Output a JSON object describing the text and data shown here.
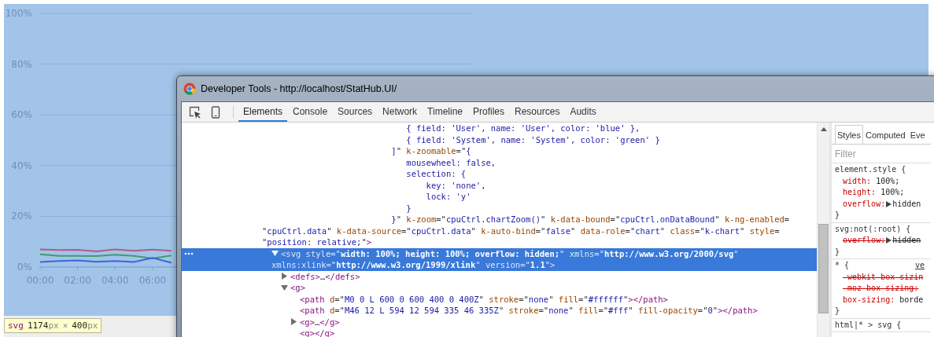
{
  "chart_page": {
    "chart_data": {
      "type": "line",
      "grid": true,
      "x": [
        0,
        1,
        2,
        3,
        4,
        5,
        6,
        7
      ],
      "xlim": [
        0,
        23
      ],
      "xticks": [
        {
          "value": 0,
          "label": "00:00"
        },
        {
          "value": 2,
          "label": "02:00"
        },
        {
          "value": 4,
          "label": "04:00"
        },
        {
          "value": 6,
          "label": "06:00"
        }
      ],
      "ylim": [
        0,
        100
      ],
      "yticks": [
        {
          "value": 0,
          "label": "0%"
        },
        {
          "value": 20,
          "label": "20%"
        },
        {
          "value": 40,
          "label": "40%"
        },
        {
          "value": 60,
          "label": "60%"
        },
        {
          "value": 80,
          "label": "80%"
        },
        {
          "value": 100,
          "label": "100%"
        }
      ],
      "series": [
        {
          "color": "#b05c84",
          "values": [
            7,
            6.7,
            6.8,
            6.2,
            7,
            6.4,
            6.9,
            6.4
          ]
        },
        {
          "color": "#3e9d6e",
          "values": [
            5,
            4.4,
            4.4,
            4.3,
            4.9,
            4.4,
            3.4,
            4.6
          ]
        },
        {
          "color": "#3f63e0",
          "values": [
            2,
            2.4,
            2.6,
            2.1,
            2.4,
            2,
            3.6,
            1.7
          ]
        }
      ]
    }
  },
  "size_tooltip": {
    "segments": [
      {
        "kind": "tag",
        "text": "svg"
      },
      {
        "kind": "num",
        "text": "1174"
      },
      {
        "kind": "unit",
        "text": "px"
      },
      {
        "kind": "sep",
        "text": "×"
      },
      {
        "kind": "num",
        "text": "400"
      },
      {
        "kind": "unit",
        "text": "px"
      }
    ]
  },
  "devtools": {
    "title": "Developer Tools - http://localhost/StatHub.UI/",
    "tabs": [
      {
        "label": "Elements",
        "selected": true
      },
      {
        "label": "Console",
        "selected": false
      },
      {
        "label": "Sources",
        "selected": false
      },
      {
        "label": "Network",
        "selected": false
      },
      {
        "label": "Timeline",
        "selected": false
      },
      {
        "label": "Profiles",
        "selected": false
      },
      {
        "label": "Resources",
        "selected": false
      },
      {
        "label": "Audits",
        "selected": false
      }
    ],
    "dom_tree": {
      "continued": true,
      "selected": false,
      "lines": [
        [
          {
            "kind": "val",
            "text": "                             { field: 'User', name: 'User', color: 'blue' },"
          }
        ],
        [
          {
            "kind": "val",
            "text": "                             { field: 'System', name: 'System', color: 'green' }"
          }
        ],
        [
          {
            "kind": "val",
            "text": "                          ]"
          },
          {
            "kind": "plain",
            "text": "\" "
          },
          {
            "kind": "attr",
            "text": "k-zoomable"
          },
          {
            "kind": "plain",
            "text": "=\""
          },
          {
            "kind": "val",
            "text": "{"
          }
        ],
        [
          {
            "kind": "val",
            "text": "                             mousewheel: false,"
          }
        ],
        [
          {
            "kind": "val",
            "text": "                             selection: {"
          }
        ],
        [
          {
            "kind": "val",
            "text": "                                 key: 'none',"
          }
        ],
        [
          {
            "kind": "val",
            "text": "                                 lock: 'y'"
          }
        ],
        [
          {
            "kind": "val",
            "text": "                             }"
          }
        ],
        [
          {
            "kind": "val",
            "text": "                          }"
          },
          {
            "kind": "plain",
            "text": "\" "
          },
          {
            "kind": "attr",
            "text": "k-zoom"
          },
          {
            "kind": "plain",
            "text": "=\""
          },
          {
            "kind": "val",
            "text": "cpuCtrl.chartZoom()"
          },
          {
            "kind": "plain",
            "text": "\" "
          },
          {
            "kind": "attr",
            "text": "k-data-bound"
          },
          {
            "kind": "plain",
            "text": "=\""
          },
          {
            "kind": "val",
            "text": "cpuCtrl.onDataBound"
          },
          {
            "kind": "plain",
            "text": "\" "
          },
          {
            "kind": "attr",
            "text": "k-ng-enabled"
          },
          {
            "kind": "plain",
            "text": "="
          }
        ],
        [
          {
            "kind": "plain",
            "text": "\""
          },
          {
            "kind": "val",
            "text": "cpuCtrl.data"
          },
          {
            "kind": "plain",
            "text": "\" "
          },
          {
            "kind": "attr",
            "text": "k-data-source"
          },
          {
            "kind": "plain",
            "text": "=\""
          },
          {
            "kind": "val",
            "text": "cpuCtrl.data"
          },
          {
            "kind": "plain",
            "text": "\" "
          },
          {
            "kind": "attr",
            "text": "k-auto-bind"
          },
          {
            "kind": "plain",
            "text": "=\""
          },
          {
            "kind": "val",
            "text": "false"
          },
          {
            "kind": "plain",
            "text": "\" "
          },
          {
            "kind": "attr",
            "text": "data-role"
          },
          {
            "kind": "plain",
            "text": "=\""
          },
          {
            "kind": "val",
            "text": "chart"
          },
          {
            "kind": "plain",
            "text": "\" "
          },
          {
            "kind": "attr",
            "text": "class"
          },
          {
            "kind": "plain",
            "text": "=\""
          },
          {
            "kind": "val",
            "text": "k-chart"
          },
          {
            "kind": "plain",
            "text": "\" "
          },
          {
            "kind": "attr",
            "text": "style"
          },
          {
            "kind": "plain",
            "text": "="
          }
        ],
        [
          {
            "kind": "plain",
            "text": "\""
          },
          {
            "kind": "val",
            "text": "position: relative;"
          },
          {
            "kind": "plain",
            "text": "\""
          },
          {
            "kind": "tag",
            "text": ">"
          }
        ]
      ],
      "children": [
        {
          "selected": true,
          "expanded": true,
          "lines": [
            [
              {
                "kind": "tag",
                "text": "<svg"
              },
              {
                "kind": "attr",
                "text": " style"
              },
              {
                "kind": "plain",
                "text": "=\""
              },
              {
                "kind": "val",
                "text": "width: 100%; height: 100%; overflow: hidden;"
              },
              {
                "kind": "plain",
                "text": "\" "
              },
              {
                "kind": "attr",
                "text": "xmlns"
              },
              {
                "kind": "plain",
                "text": "=\""
              },
              {
                "kind": "val",
                "text": "http://www.w3.org/2000/svg"
              },
              {
                "kind": "plain",
                "text": "\""
              }
            ],
            [
              {
                "kind": "attr",
                "text": "xmlns:xlink"
              },
              {
                "kind": "plain",
                "text": "=\""
              },
              {
                "kind": "val",
                "text": "http://www.w3.org/1999/xlink"
              },
              {
                "kind": "plain",
                "text": "\" "
              },
              {
                "kind": "attr",
                "text": "version"
              },
              {
                "kind": "plain",
                "text": "=\""
              },
              {
                "kind": "val",
                "text": "1.1"
              },
              {
                "kind": "plain",
                "text": "\""
              },
              {
                "kind": "tag",
                "text": ">"
              }
            ]
          ],
          "children": [
            {
              "selected": false,
              "expanded": false,
              "lines": [
                [
                  {
                    "kind": "tag",
                    "text": "<defs>"
                  },
                  {
                    "kind": "plain",
                    "text": "…"
                  },
                  {
                    "kind": "tag",
                    "text": "</defs>"
                  }
                ]
              ]
            },
            {
              "selected": false,
              "expanded": true,
              "lines": [
                [
                  {
                    "kind": "tag",
                    "text": "<g>"
                  }
                ]
              ],
              "children": [
                {
                  "selected": false,
                  "lines": [
                    [
                      {
                        "kind": "tag",
                        "text": "<path"
                      },
                      {
                        "kind": "attr",
                        "text": " d"
                      },
                      {
                        "kind": "plain",
                        "text": "=\""
                      },
                      {
                        "kind": "val",
                        "text": "M0 0 L 600 0 600 400 0 400Z"
                      },
                      {
                        "kind": "plain",
                        "text": "\" "
                      },
                      {
                        "kind": "attr",
                        "text": "stroke"
                      },
                      {
                        "kind": "plain",
                        "text": "=\""
                      },
                      {
                        "kind": "val",
                        "text": "none"
                      },
                      {
                        "kind": "plain",
                        "text": "\" "
                      },
                      {
                        "kind": "attr",
                        "text": "fill"
                      },
                      {
                        "kind": "plain",
                        "text": "=\""
                      },
                      {
                        "kind": "val",
                        "text": "#ffffff"
                      },
                      {
                        "kind": "plain",
                        "text": "\""
                      },
                      {
                        "kind": "tag",
                        "text": "></path>"
                      }
                    ]
                  ]
                },
                {
                  "selected": false,
                  "lines": [
                    [
                      {
                        "kind": "tag",
                        "text": "<path"
                      },
                      {
                        "kind": "attr",
                        "text": " d"
                      },
                      {
                        "kind": "plain",
                        "text": "=\""
                      },
                      {
                        "kind": "val",
                        "text": "M46 12 L 594 12 594 335 46 335Z"
                      },
                      {
                        "kind": "plain",
                        "text": "\" "
                      },
                      {
                        "kind": "attr",
                        "text": "stroke"
                      },
                      {
                        "kind": "plain",
                        "text": "=\""
                      },
                      {
                        "kind": "val",
                        "text": "none"
                      },
                      {
                        "kind": "plain",
                        "text": "\" "
                      },
                      {
                        "kind": "attr",
                        "text": "fill"
                      },
                      {
                        "kind": "plain",
                        "text": "=\""
                      },
                      {
                        "kind": "val",
                        "text": "#fff"
                      },
                      {
                        "kind": "plain",
                        "text": "\" "
                      },
                      {
                        "kind": "attr",
                        "text": "fill-opacity"
                      },
                      {
                        "kind": "plain",
                        "text": "=\""
                      },
                      {
                        "kind": "val",
                        "text": "0"
                      },
                      {
                        "kind": "plain",
                        "text": "\""
                      },
                      {
                        "kind": "tag",
                        "text": "></path>"
                      }
                    ]
                  ]
                },
                {
                  "selected": false,
                  "expanded": false,
                  "lines": [
                    [
                      {
                        "kind": "tag",
                        "text": "<g>"
                      },
                      {
                        "kind": "plain",
                        "text": "…"
                      },
                      {
                        "kind": "tag",
                        "text": "</g>"
                      }
                    ]
                  ]
                },
                {
                  "selected": false,
                  "lines": [
                    [
                      {
                        "kind": "tag",
                        "text": "<g></g>"
                      }
                    ]
                  ]
                }
              ]
            }
          ]
        }
      ]
    },
    "styles_pane": {
      "tabs": [
        {
          "label": "Styles",
          "selected": true
        },
        {
          "label": "Computed",
          "selected": false
        },
        {
          "label": "Eve",
          "selected": false
        }
      ],
      "filter_placeholder": "Filter",
      "rules": [
        {
          "selector": "element.style {",
          "properties": [
            {
              "name": "width:",
              "value": "100%;",
              "overridden": false
            },
            {
              "name": "height:",
              "value": "100%;",
              "overridden": false
            },
            {
              "name": "overflow:",
              "expandable": true,
              "value": "hidden",
              "overridden": false
            }
          ],
          "close": "}"
        },
        {
          "selector": "svg:not(:root) {",
          "properties": [
            {
              "name": "overflow:",
              "expandable": true,
              "value": "hidden",
              "overridden": true
            }
          ],
          "close": "}"
        },
        {
          "selector": "* {",
          "source": "ve",
          "properties": [
            {
              "name": "-webkit-box-sizin",
              "overridden": true
            },
            {
              "name": "-moz-box-sizing:",
              "overridden": true
            },
            {
              "name": "box-sizing:",
              "value": "borde",
              "overridden": false
            }
          ],
          "close": "}"
        },
        {
          "selector": "html|* > svg {"
        }
      ]
    }
  }
}
